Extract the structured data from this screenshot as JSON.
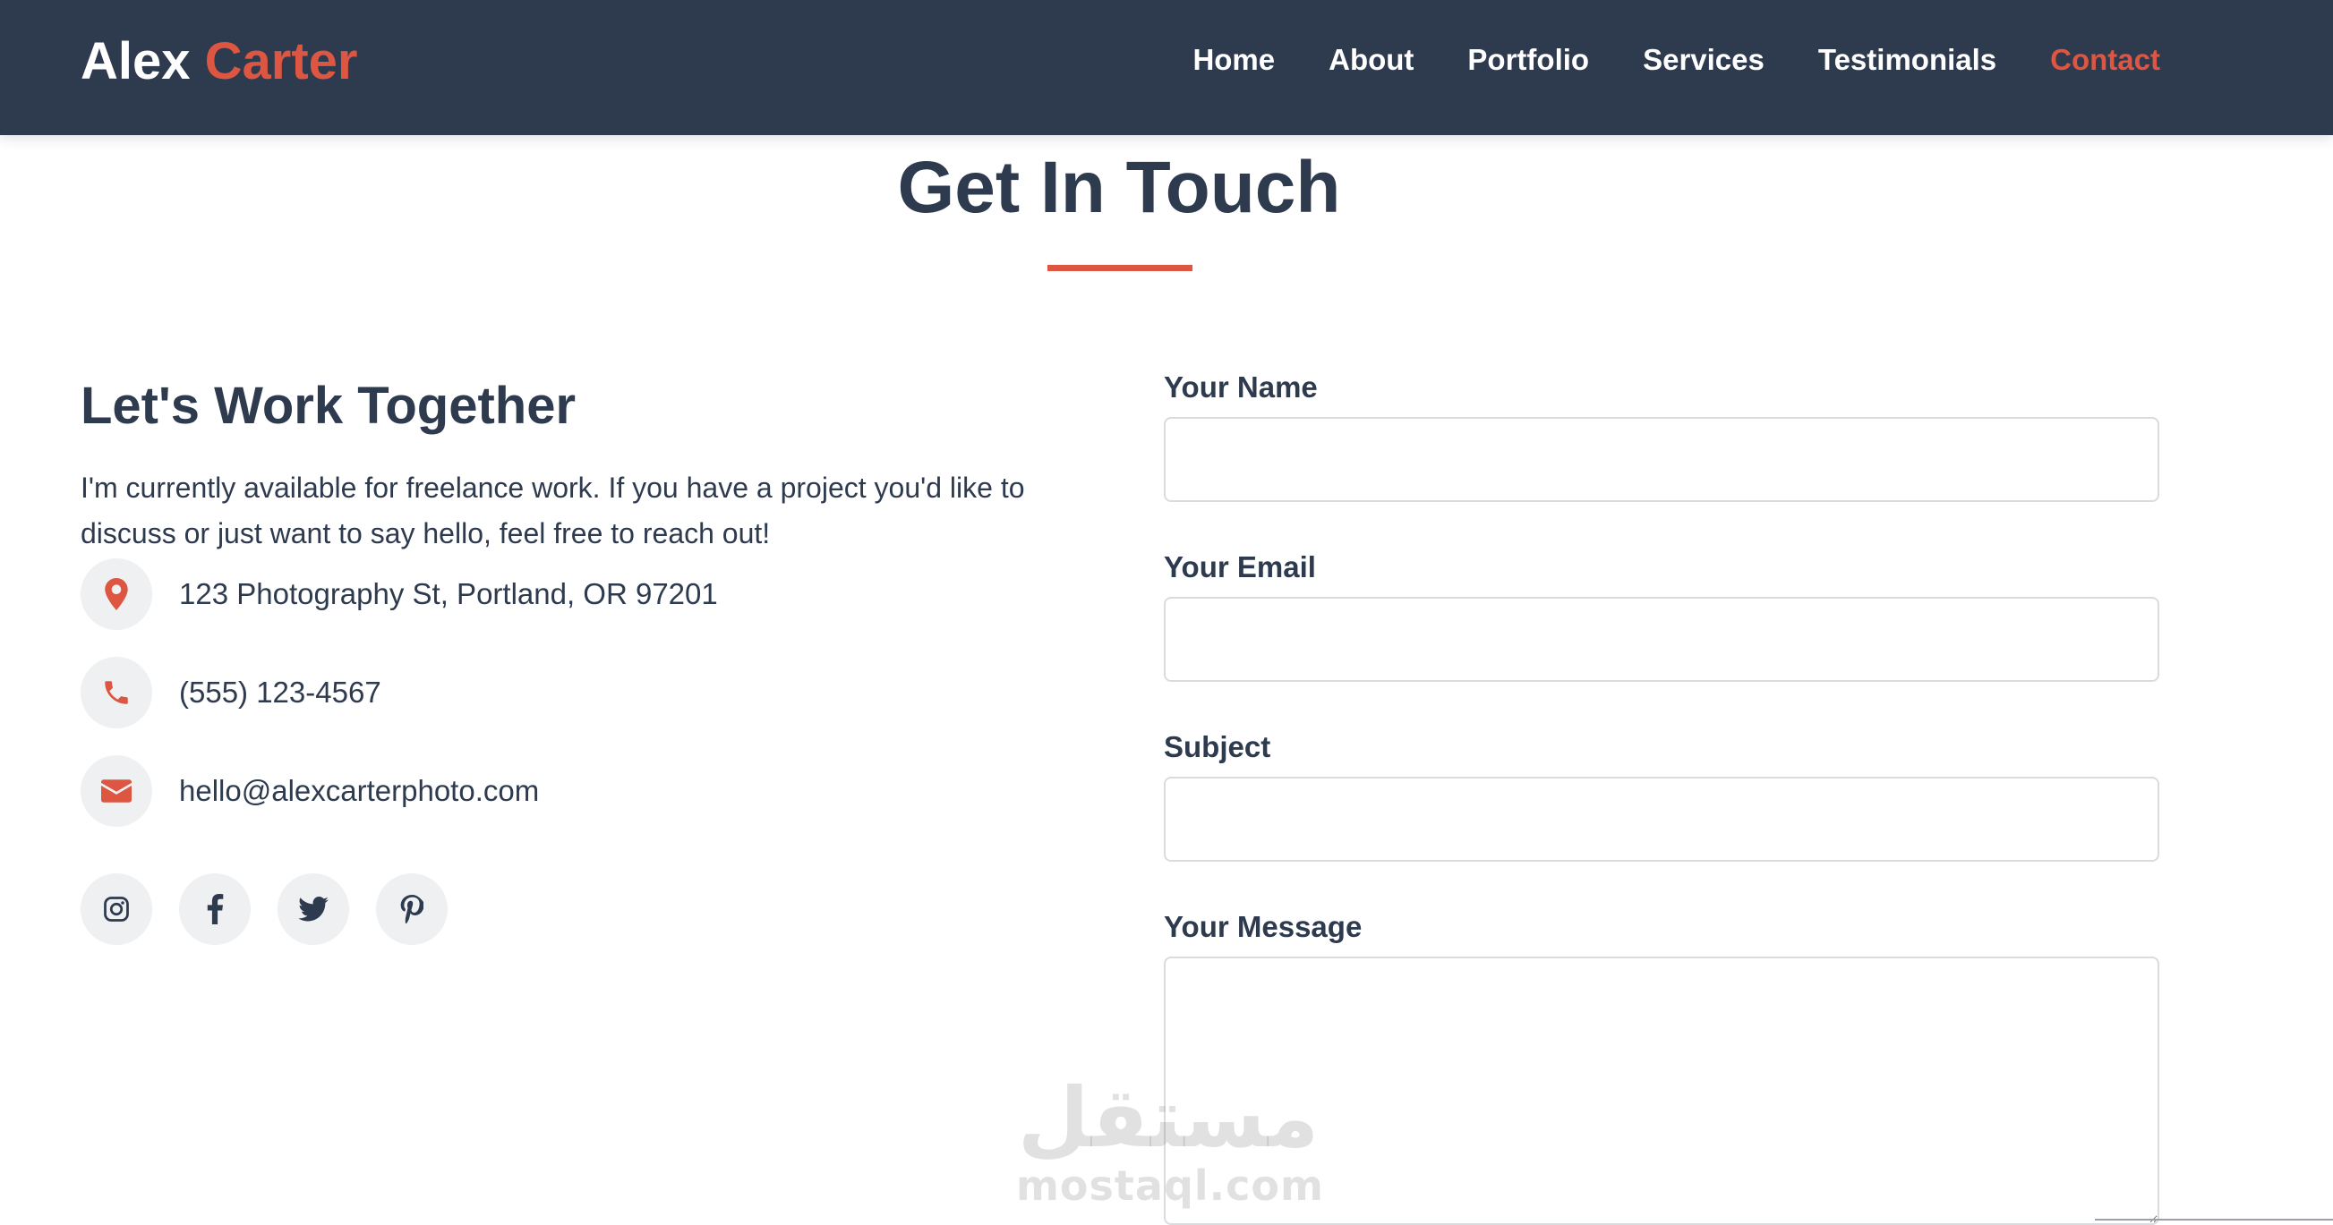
{
  "brand": {
    "first": "Alex",
    "last": "Carter"
  },
  "nav": {
    "items": [
      "Home",
      "About",
      "Portfolio",
      "Services",
      "Testimonials",
      "Contact"
    ],
    "active": "Contact"
  },
  "section": {
    "title": "Get In Touch"
  },
  "contact_info": {
    "heading": "Let's Work Together",
    "intro": "I'm currently available for freelance work. If you have a project you'd like to discuss or just want to say hello, feel free to reach out!",
    "address": "123 Photography St, Portland, OR 97201",
    "phone": "(555) 123-4567",
    "email": "hello@alexcarterphoto.com"
  },
  "social": [
    "instagram-icon",
    "facebook-icon",
    "twitter-icon",
    "pinterest-icon"
  ],
  "form": {
    "name_label": "Your Name",
    "name_value": "",
    "email_label": "Your Email",
    "email_value": "",
    "subject_label": "Subject",
    "subject_value": "",
    "message_label": "Your Message",
    "message_value": ""
  },
  "watermark": {
    "arabic": "مستقل",
    "latin": "mostaql.com"
  },
  "colors": {
    "header_bg": "#2e3a4e",
    "accent": "#dd5642",
    "text": "#2e3a4e",
    "icon_bg": "#eef0f2",
    "input_border": "#d9dbdf"
  }
}
